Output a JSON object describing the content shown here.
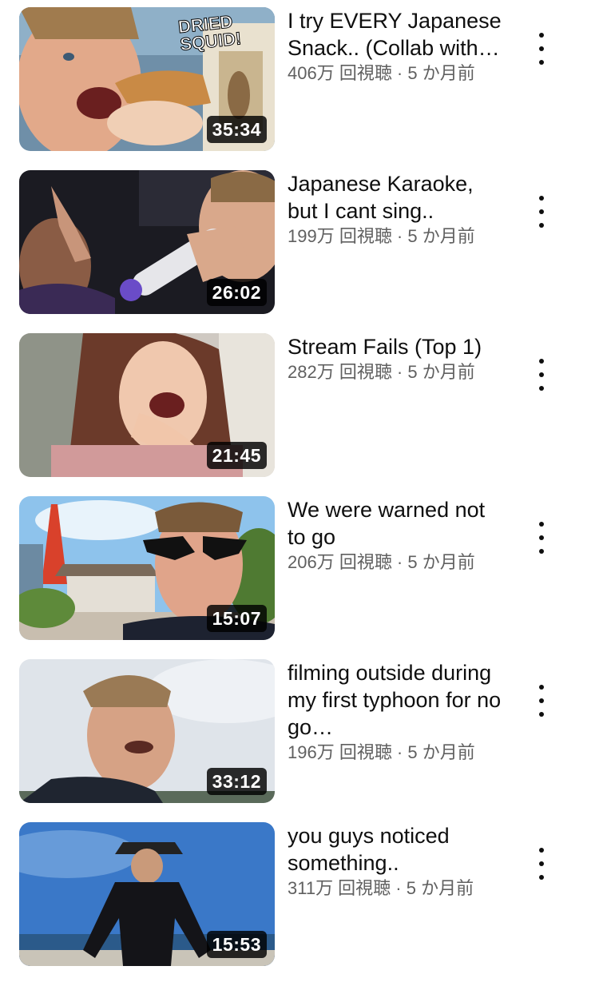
{
  "colors": {
    "title_text": "#0f0f0f",
    "meta_text": "#606060",
    "duration_bg": "#000000",
    "duration_text": "#ffffff"
  },
  "videos": [
    {
      "title": "I try EVERY Japanese Snack.. (Collab with…",
      "meta": "406万 回視聴 · 5 か月前",
      "duration": "35:34",
      "overlay_text": "DRIED SQUID!",
      "menu_icon": "more-vert-icon"
    },
    {
      "title": "Japanese Karaoke, but I cant sing..",
      "meta": "199万 回視聴 · 5 か月前",
      "duration": "26:02",
      "menu_icon": "more-vert-icon"
    },
    {
      "title": "Stream Fails (Top 1)",
      "meta": "282万 回視聴 · 5 か月前",
      "duration": "21:45",
      "menu_icon": "more-vert-icon"
    },
    {
      "title": "We were warned not to go",
      "meta": "206万 回視聴 · 5 か月前",
      "duration": "15:07",
      "menu_icon": "more-vert-icon"
    },
    {
      "title": "filming outside during my first typhoon for no go…",
      "meta": "196万 回視聴 · 5 か月前",
      "duration": "33:12",
      "menu_icon": "more-vert-icon"
    },
    {
      "title": "you guys noticed something..",
      "meta": "311万 回視聴 · 5 か月前",
      "duration": "15:53",
      "menu_icon": "more-vert-icon"
    }
  ]
}
